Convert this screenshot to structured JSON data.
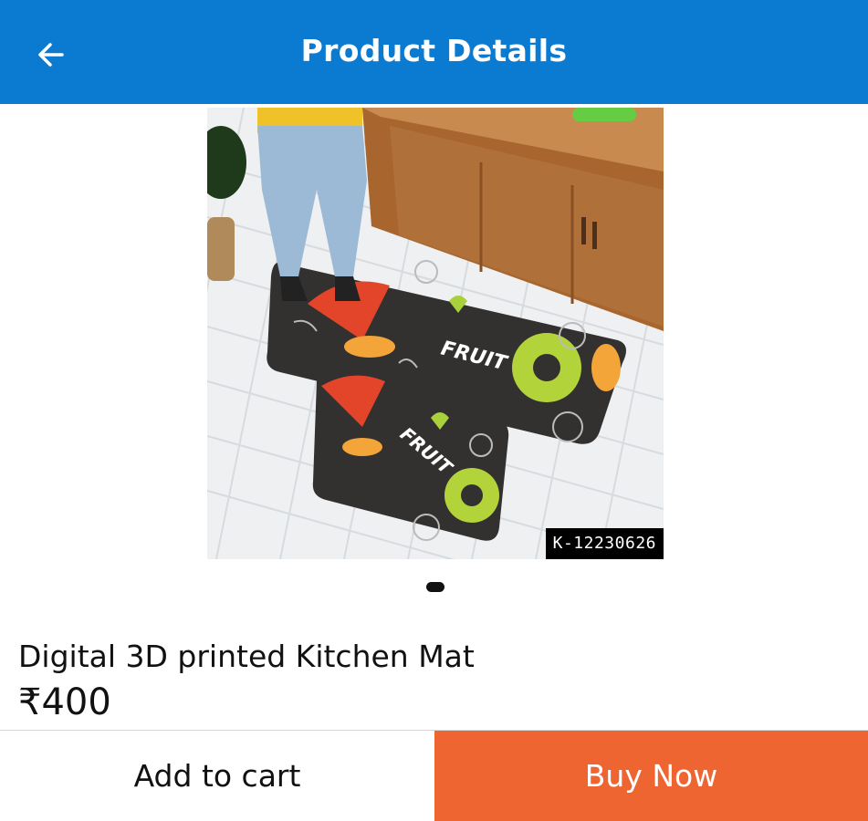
{
  "header": {
    "title": "Product Details",
    "back_icon": "arrow-left-icon",
    "background_color": "#0b7bd1"
  },
  "product": {
    "image_alt": "Kitchen mat with fruit print",
    "sku_badge": "K-12230626",
    "mat_print_text": "FRUIT",
    "title": "Digital 3D printed Kitchen Mat",
    "price": "₹400"
  },
  "carousel": {
    "pages": 1,
    "current": 1
  },
  "actions": {
    "add_to_cart_label": "Add to cart",
    "buy_now_label": "Buy Now",
    "buy_now_color": "#ee6532"
  }
}
